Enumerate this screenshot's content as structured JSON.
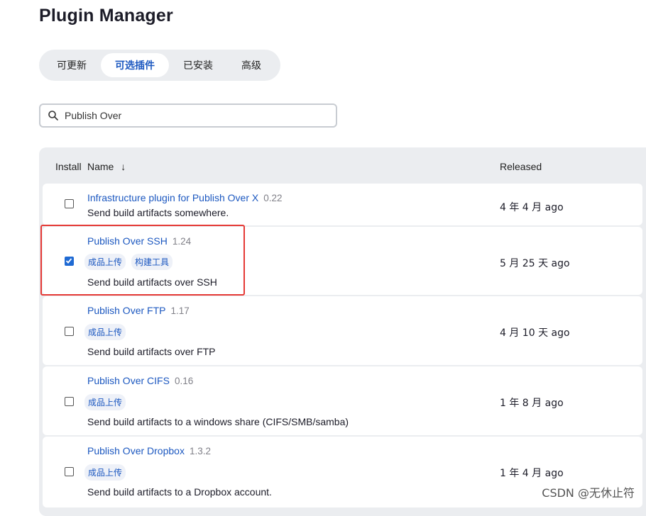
{
  "page": {
    "title": "Plugin Manager"
  },
  "tabs": [
    {
      "label": "可更新",
      "active": false
    },
    {
      "label": "可选插件",
      "active": true
    },
    {
      "label": "已安装",
      "active": false
    },
    {
      "label": "高级",
      "active": false
    }
  ],
  "search": {
    "value": "Publish Over"
  },
  "table": {
    "headers": {
      "install": "Install",
      "name": "Name",
      "sort_indicator": "↓",
      "released": "Released"
    },
    "rows": [
      {
        "name": "Infrastructure plugin for Publish Over X",
        "version": "0.22",
        "tags": [],
        "excerpt": "Send build artifacts somewhere.",
        "released": "4 年 4 月 ago",
        "checked": false
      },
      {
        "name": "Publish Over SSH",
        "version": "1.24",
        "tags": [
          "成品上传",
          "构建工具"
        ],
        "excerpt": "Send build artifacts over SSH",
        "released": "5 月 25 天 ago",
        "checked": true
      },
      {
        "name": "Publish Over FTP",
        "version": "1.17",
        "tags": [
          "成品上传"
        ],
        "excerpt": "Send build artifacts over FTP",
        "released": "4 月 10 天 ago",
        "checked": false
      },
      {
        "name": "Publish Over CIFS",
        "version": "0.16",
        "tags": [
          "成品上传"
        ],
        "excerpt": "Send build artifacts to a windows share (CIFS/SMB/samba)",
        "released": "1 年 8 月 ago",
        "checked": false
      },
      {
        "name": "Publish Over Dropbox",
        "version": "1.3.2",
        "tags": [
          "成品上传"
        ],
        "excerpt": "Send build artifacts to a Dropbox account.",
        "released": "1 年 4 月 ago",
        "checked": false
      }
    ]
  },
  "colors": {
    "accent": "#1c58c0",
    "checkbox_checked": "#1f6ad3",
    "highlight": "#e53935",
    "table_bg": "#ebedf0"
  },
  "watermark": "CSDN @无休止符"
}
